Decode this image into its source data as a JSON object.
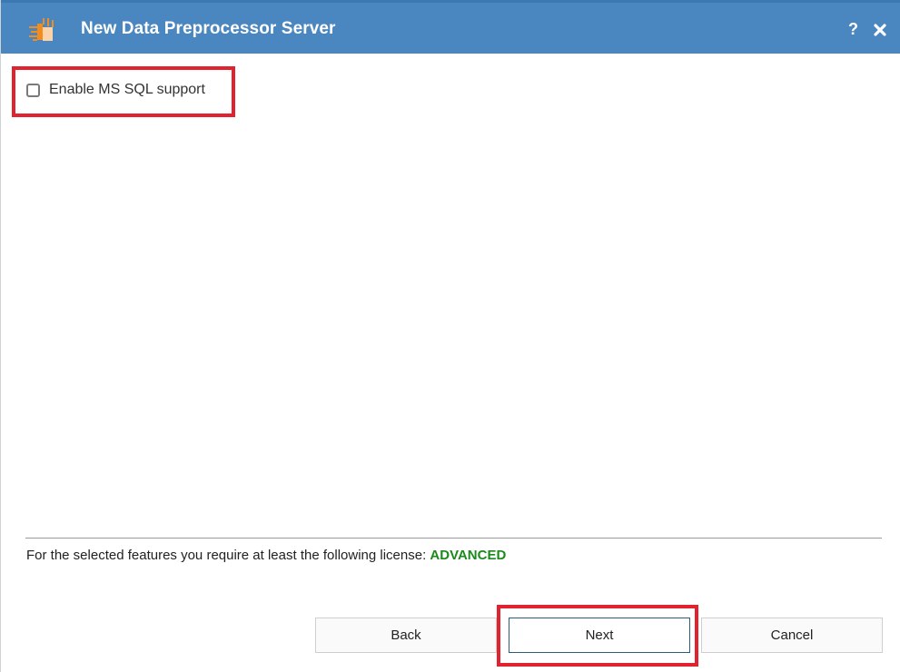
{
  "window": {
    "title": "New Data Preprocessor Server",
    "icons": {
      "app": "data-preprocessor-server-icon",
      "help": "?",
      "close": "close-icon"
    },
    "colors": {
      "titlebar": "#4a86bf",
      "highlight": "#e0232f",
      "license_level": "#1a8a1a"
    }
  },
  "options": {
    "ms_sql": {
      "label": "Enable MS SQL support",
      "checked": false
    }
  },
  "license": {
    "text": "For the selected features you require at least the following license: ",
    "level": "ADVANCED"
  },
  "buttons": {
    "back": "Back",
    "next": "Next",
    "cancel": "Cancel"
  }
}
